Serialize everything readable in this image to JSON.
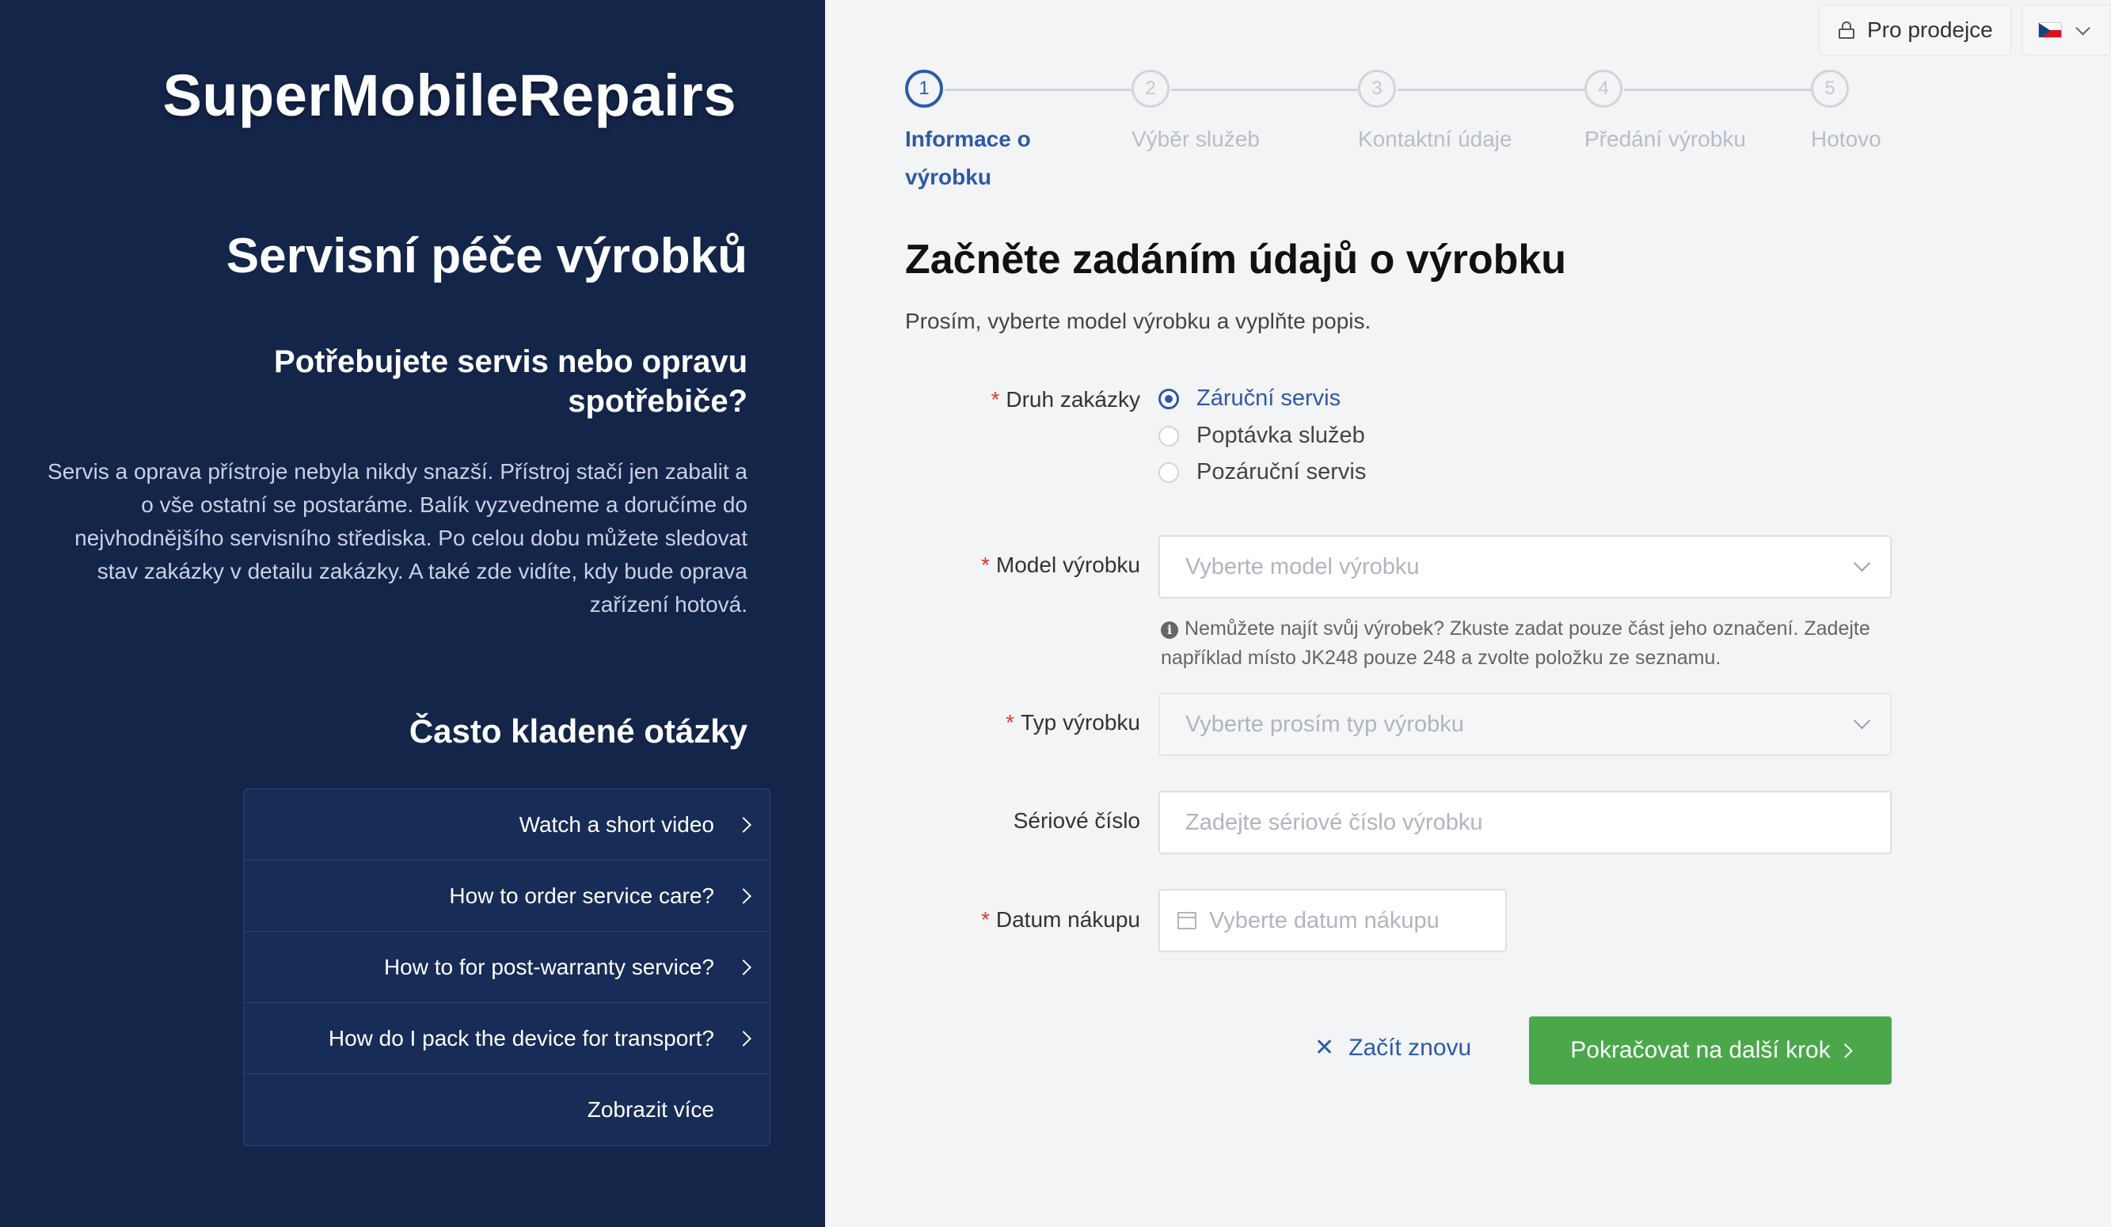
{
  "brand": "SuperMobileRepairs",
  "left": {
    "title": "Servisní péče výrobků",
    "subtitle": "Potřebujete servis nebo opravu spotřebiče?",
    "intro": "Servis a oprava přístroje nebyla nikdy snazší. Přístroj stačí jen zabalit a o vše ostatní se postaráme. Balík vyzvedneme a doručíme do nejvhodnějšího servisního střediska. Po celou dobu můžete sledovat stav zakázky v detailu zakázky. A také zde vidíte, kdy bude oprava zařízení hotová.",
    "faq_title": "Často kladené otázky",
    "faq": [
      {
        "label": "Watch a short video"
      },
      {
        "label": "How to order service care?"
      },
      {
        "label": "How to for post-warranty service?"
      },
      {
        "label": "How do I pack the device for transport?"
      },
      {
        "label": "Zobrazit více"
      }
    ]
  },
  "top": {
    "dealer_label": "Pro prodejce",
    "language": "CZ"
  },
  "steps": [
    {
      "num": "1",
      "label": "Informace o výrobku",
      "active": true
    },
    {
      "num": "2",
      "label": "Výběr služeb",
      "active": false
    },
    {
      "num": "3",
      "label": "Kontaktní údaje",
      "active": false
    },
    {
      "num": "4",
      "label": "Předání výrobku",
      "active": false
    },
    {
      "num": "5",
      "label": "Hotovo",
      "active": false
    }
  ],
  "form": {
    "title": "Začněte zadáním údajů o výrobku",
    "subtitle": "Prosím, vyberte model výrobku a vyplňte popis.",
    "order_type_label": "Druh zakázky",
    "order_types": [
      {
        "label": "Záruční servis",
        "checked": true
      },
      {
        "label": "Poptávka služeb",
        "checked": false
      },
      {
        "label": "Pozáruční servis",
        "checked": false
      }
    ],
    "model_label": "Model výrobku",
    "model_placeholder": "Vyberte model výrobku",
    "hint": "Nemůžete najít svůj výrobek? Zkuste zadat pouze část jeho označení. Zadejte například místo JK248 pouze 248 a zvolte položku ze seznamu.",
    "type_label": "Typ výrobku",
    "type_placeholder": "Vyberte prosím typ výrobku",
    "serial_label": "Sériové číslo",
    "serial_placeholder": "Zadejte sériové číslo výrobku",
    "date_label": "Datum nákupu",
    "date_placeholder": "Vyberte datum nákupu",
    "required_mark": "*",
    "restart_label": "Začít znovu",
    "next_label": "Pokračovat na další krok"
  },
  "colors": {
    "sidebar_bg": "#14254a",
    "accent": "#2d5aa8",
    "primary_button": "#4aa84a",
    "required": "#e0392e"
  }
}
